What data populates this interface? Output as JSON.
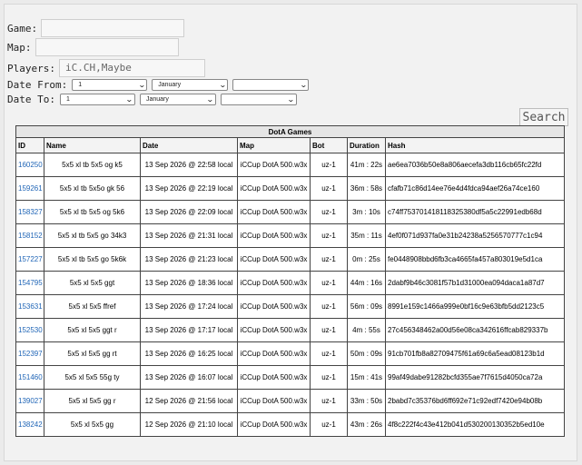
{
  "filters": {
    "game_label": "Game:",
    "game_value": "",
    "map_label": "Map:",
    "map_value": "",
    "players_label": "Players:",
    "players_value": "iC.CH,Maybe",
    "date_from_label": "Date From:",
    "date_to_label": "Date To:",
    "date_from": {
      "day": "1",
      "month": "January",
      "year": ""
    },
    "date_to": {
      "day": "1",
      "month": "January",
      "year": ""
    },
    "search_label": "Search"
  },
  "table": {
    "caption": "DotA Games",
    "headers": [
      "ID",
      "Name",
      "Date",
      "Map",
      "Bot",
      "Duration",
      "Hash"
    ],
    "rows": [
      {
        "id": "160250",
        "name": "5x5 xl tb 5x5 og k5",
        "date": "13 Sep 2026 @ 22:58 local",
        "map": "iCCup DotA 500.w3x",
        "bot": "uz-1",
        "duration": "41m : 22s",
        "hash": "ae6ea7036b50e8a806aecefa3db116cb65fc22fd"
      },
      {
        "id": "159261",
        "name": "5x5 xl tb 5x5o gk 56",
        "date": "13 Sep 2026 @ 22:19 local",
        "map": "iCCup DotA 500.w3x",
        "bot": "uz-1",
        "duration": "36m : 58s",
        "hash": "cfafb71c86d14ee76e4d4fdca94aef26a74ce160"
      },
      {
        "id": "158327",
        "name": "5x5 xl tb 5x5 og 5k6",
        "date": "13 Sep 2026 @ 22:09 local",
        "map": "iCCup DotA 500.w3x",
        "bot": "uz-1",
        "duration": "3m : 10s",
        "hash": "c74ff753701418118325380df5a5c22991edb68d"
      },
      {
        "id": "158152",
        "name": "5x5 xl tb 5x5 go 34k3",
        "date": "13 Sep 2026 @ 21:31 local",
        "map": "iCCup DotA 500.w3x",
        "bot": "uz-1",
        "duration": "35m : 11s",
        "hash": "4ef0f071d937fa0e31b24238a5256570777c1c94"
      },
      {
        "id": "157227",
        "name": "5x5 xl tb 5x5 go 5k6k",
        "date": "13 Sep 2026 @ 21:23 local",
        "map": "iCCup DotA 500.w3x",
        "bot": "uz-1",
        "duration": "0m : 25s",
        "hash": "fe0448908bbd6fb3ca4665fa457a803019e5d1ca"
      },
      {
        "id": "154795",
        "name": "5x5 xl 5x5 ggt",
        "date": "13 Sep 2026 @ 18:36 local",
        "map": "iCCup DotA 500.w3x",
        "bot": "uz-1",
        "duration": "44m : 16s",
        "hash": "2dabf9b46c3081f57b1d31000ea094daca1a87d7"
      },
      {
        "id": "153631",
        "name": "5x5 xl 5x5 ffref",
        "date": "13 Sep 2026 @ 17:24 local",
        "map": "iCCup DotA 500.w3x",
        "bot": "uz-1",
        "duration": "56m : 09s",
        "hash": "8991e159c1466a999e0bf16c9e63bfb5dd2123c5"
      },
      {
        "id": "152530",
        "name": "5x5 xl 5x5 ggt r",
        "date": "13 Sep 2026 @ 17:17 local",
        "map": "iCCup DotA 500.w3x",
        "bot": "uz-1",
        "duration": "4m : 55s",
        "hash": "27c456348462a00d56e08ca342616ffcab829337b"
      },
      {
        "id": "152397",
        "name": "5x5 xl 5x5 gg rt",
        "date": "13 Sep 2026 @ 16:25 local",
        "map": "iCCup DotA 500.w3x",
        "bot": "uz-1",
        "duration": "50m : 09s",
        "hash": "91cb701fb8a82709475f61a69c6a5ead08123b1d"
      },
      {
        "id": "151460",
        "name": "5x5 xl 5x5 55g ty",
        "date": "13 Sep 2026 @ 16:07 local",
        "map": "iCCup DotA 500.w3x",
        "bot": "uz-1",
        "duration": "15m : 41s",
        "hash": "99af49dabe91282bcfd355ae7f7615d4050ca72a"
      },
      {
        "id": "139027",
        "name": "5x5 xl 5x5 gg r",
        "date": "12 Sep 2026 @ 21:56 local",
        "map": "iCCup DotA 500.w3x",
        "bot": "uz-1",
        "duration": "33m : 50s",
        "hash": "2babd7c35376bd6ff692e71c92edf7420e94b08b"
      },
      {
        "id": "138242",
        "name": "5x5 xl 5x5 gg",
        "date": "12 Sep 2026 @ 21:10 local",
        "map": "iCCup DotA 500.w3x",
        "bot": "uz-1",
        "duration": "43m : 26s",
        "hash": "4f8c222f4c43e412b041d530200130352b5ed10e"
      }
    ]
  }
}
